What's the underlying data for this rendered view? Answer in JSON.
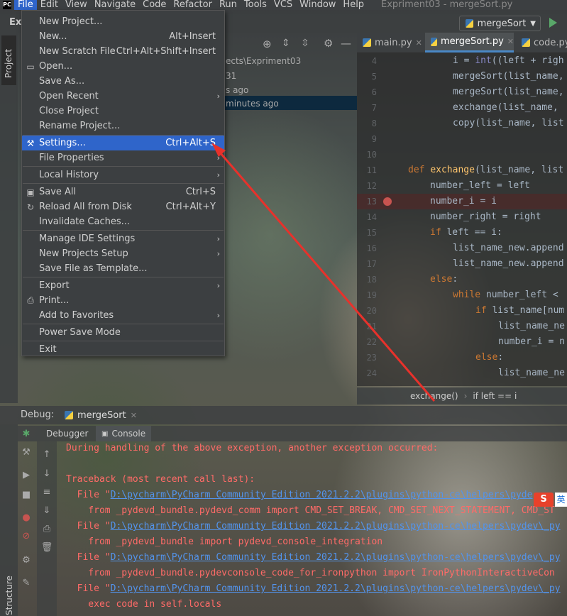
{
  "menubar": {
    "items": [
      "File",
      "Edit",
      "View",
      "Navigate",
      "Code",
      "Refactor",
      "Run",
      "Tools",
      "VCS",
      "Window",
      "Help"
    ],
    "window_title": "Expriment03 - mergeSort.py"
  },
  "toolbar": {
    "project_name": "Exp",
    "run_config": "mergeSort"
  },
  "sidebar": {
    "project_tab": "Project",
    "structure_tab": "Structure"
  },
  "project_panel": {
    "path_fragment": "ects\\Expriment03",
    "line2": "31",
    "line3": "s ago",
    "selected_row": "minutes ago"
  },
  "file_menu": {
    "items": [
      {
        "label": "New Project...",
        "shortcut": "",
        "submenu": false
      },
      {
        "label": "New...",
        "shortcut": "Alt+Insert",
        "submenu": false
      },
      {
        "label": "New Scratch File",
        "shortcut": "Ctrl+Alt+Shift+Insert",
        "submenu": false
      },
      {
        "label": "Open...",
        "shortcut": "",
        "submenu": false
      },
      {
        "label": "Save As...",
        "shortcut": "",
        "submenu": false
      },
      {
        "label": "Open Recent",
        "shortcut": "",
        "submenu": true
      },
      {
        "label": "Close Project",
        "shortcut": "",
        "submenu": false
      },
      {
        "label": "Rename Project...",
        "shortcut": "",
        "submenu": false
      },
      {
        "label": "Settings...",
        "shortcut": "Ctrl+Alt+S",
        "submenu": false
      },
      {
        "label": "File Properties",
        "shortcut": "",
        "submenu": true
      },
      {
        "label": "Local History",
        "shortcut": "",
        "submenu": true
      },
      {
        "label": "Save All",
        "shortcut": "Ctrl+S",
        "submenu": false
      },
      {
        "label": "Reload All from Disk",
        "shortcut": "Ctrl+Alt+Y",
        "submenu": false
      },
      {
        "label": "Invalidate Caches...",
        "shortcut": "",
        "submenu": false
      },
      {
        "label": "Manage IDE Settings",
        "shortcut": "",
        "submenu": true
      },
      {
        "label": "New Projects Setup",
        "shortcut": "",
        "submenu": true
      },
      {
        "label": "Save File as Template...",
        "shortcut": "",
        "submenu": false
      },
      {
        "label": "Export",
        "shortcut": "",
        "submenu": true
      },
      {
        "label": "Print...",
        "shortcut": "",
        "submenu": false
      },
      {
        "label": "Add to Favorites",
        "shortcut": "",
        "submenu": true
      },
      {
        "label": "Power Save Mode",
        "shortcut": "",
        "submenu": false
      },
      {
        "label": "Exit",
        "shortcut": "",
        "submenu": false
      }
    ]
  },
  "editor": {
    "tabs": [
      "main.py",
      "mergeSort.py",
      "code.py"
    ],
    "line_numbers": [
      "4",
      "5",
      "6",
      "7",
      "8",
      "9",
      "10",
      "11",
      "12",
      "13",
      "14",
      "15",
      "16",
      "17",
      "18",
      "19",
      "20",
      "21",
      "22",
      "23",
      "24"
    ],
    "breadcrumb": [
      "exchange()",
      "if left == i"
    ]
  },
  "debug": {
    "label": "Debug:",
    "session": "mergeSort",
    "tabs": [
      "Debugger",
      "Console"
    ]
  },
  "console": {
    "lines": [
      {
        "pre": "During handling of the above exception, another exception occurred:",
        "link": "",
        "post": ""
      },
      {
        "pre": "",
        "link": "",
        "post": ""
      },
      {
        "pre": "Traceback (most recent call last):",
        "link": "",
        "post": ""
      },
      {
        "pre": "  File \"",
        "link": "D:\\pycharm\\PyCharm Community Edition 2021.2.2\\plugins\\python-ce\\helpers\\pyde",
        "post": ""
      },
      {
        "pre": "    from _pydevd_bundle.pydevd_comm import CMD_SET_BREAK, CMD_SET_NEXT_STATEMENT, CMD_ST",
        "link": "",
        "post": ""
      },
      {
        "pre": "  File \"",
        "link": "D:\\pycharm\\PyCharm Community Edition 2021.2.2\\plugins\\python-ce\\helpers\\pydev\\_py",
        "post": ""
      },
      {
        "pre": "    from _pydevd_bundle import pydevd_console_integration",
        "link": "",
        "post": ""
      },
      {
        "pre": "  File \"",
        "link": "D:\\pycharm\\PyCharm Community Edition 2021.2.2\\plugins\\python-ce\\helpers\\pydev\\_py",
        "post": ""
      },
      {
        "pre": "    from _pydevd_bundle.pydevconsole_code_for_ironpython import IronPythonInteractiveCon",
        "link": "",
        "post": ""
      },
      {
        "pre": "  File \"",
        "link": "D:\\pycharm\\PyCharm Community Edition 2021.2.2\\plugins\\python-ce\\helpers\\pydev\\_py",
        "post": ""
      },
      {
        "pre": "    exec code in self.locals",
        "link": "",
        "post": ""
      }
    ]
  },
  "ime": {
    "logo": "S",
    "lang": "英"
  },
  "colors": {
    "accent": "#2f65ca",
    "error_text": "#ff6b68",
    "link": "#5394ec",
    "annotation_arrow": "#e8312b"
  }
}
